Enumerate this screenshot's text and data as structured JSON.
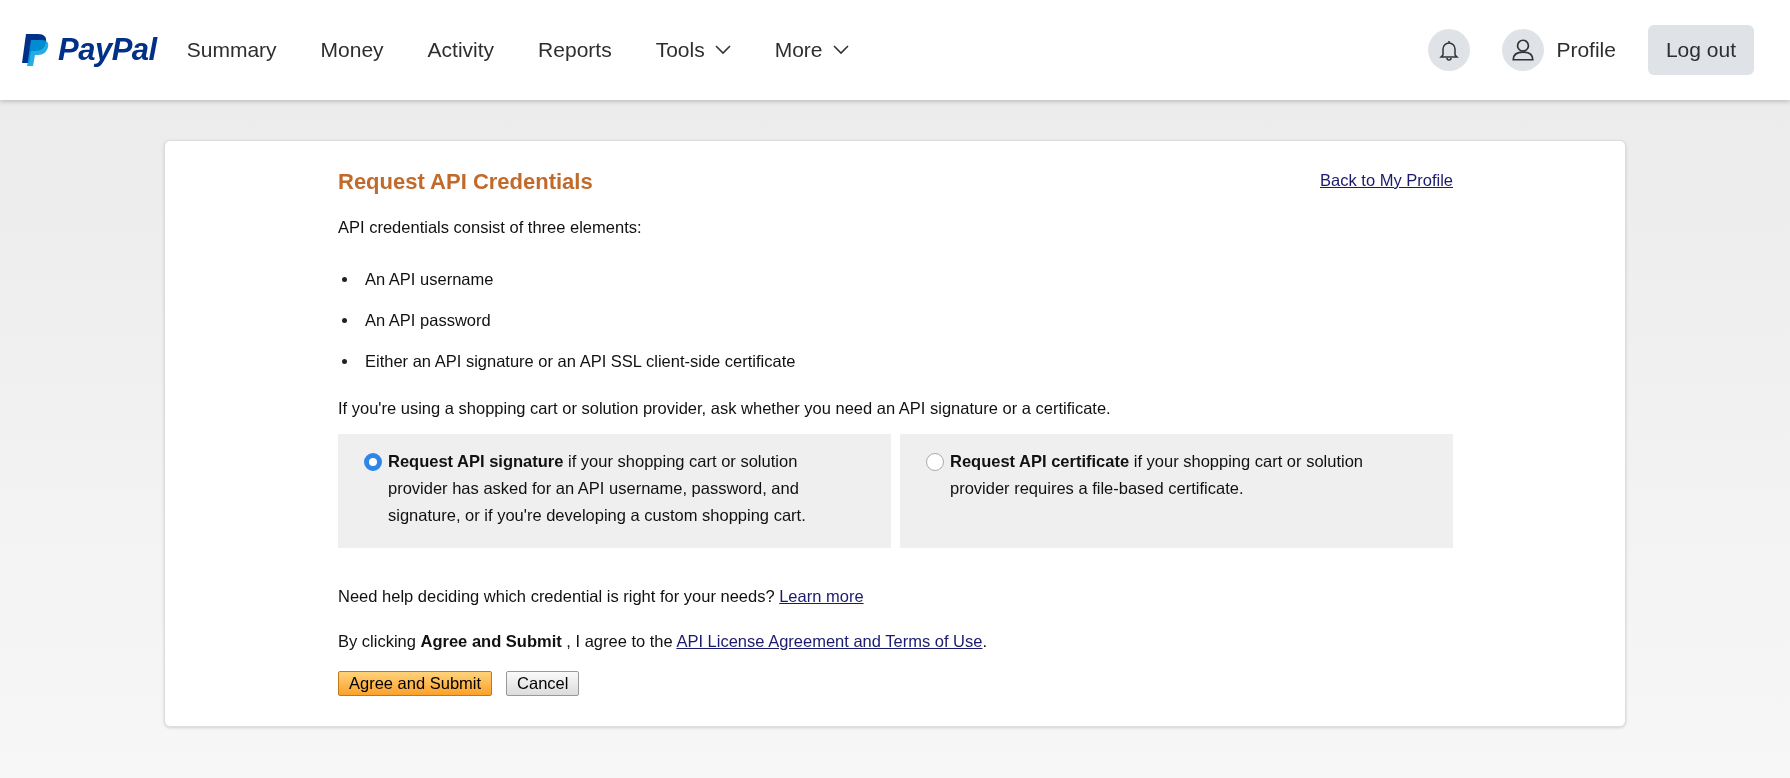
{
  "header": {
    "logo": "PayPal",
    "nav": [
      {
        "label": "Summary",
        "has_menu": false
      },
      {
        "label": "Money",
        "has_menu": false
      },
      {
        "label": "Activity",
        "has_menu": false
      },
      {
        "label": "Reports",
        "has_menu": false
      },
      {
        "label": "Tools",
        "has_menu": true
      },
      {
        "label": "More",
        "has_menu": true
      }
    ],
    "profile": "Profile",
    "logout": "Log out"
  },
  "page": {
    "title": "Request API Credentials",
    "back_link": "Back to My Profile",
    "intro": "API credentials consist of three elements:",
    "elements": [
      "An API username",
      "An API password",
      "Either an API signature or an API SSL client-side certificate"
    ],
    "note": "If you're using a shopping cart or solution provider, ask whether you need an API signature or a certificate.",
    "options": [
      {
        "text": "**Request API signature** if your shopping cart or solution provider has asked for an API username, password, and signature, or if you're developing a custom shopping cart.",
        "selected": true
      },
      {
        "text": "**Request API certificate** if your shopping cart or solution provider requires a file-based certificate.",
        "selected": false
      }
    ],
    "help": {
      "text": "Need help deciding which credential is right for your needs?",
      "link": "Learn more"
    },
    "agree": {
      "text": "By clicking **Agree and Submit** , I agree to the",
      "link": "API License Agreement and Terms of Use",
      "end": "."
    },
    "buttons": {
      "submit": "Agree and Submit",
      "cancel": "Cancel"
    }
  }
}
